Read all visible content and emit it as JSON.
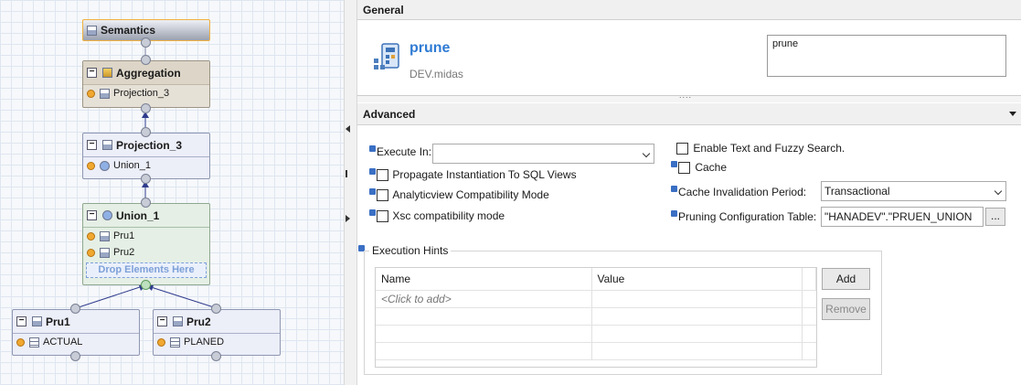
{
  "canvas": {
    "semantics": {
      "title": "Semantics"
    },
    "aggregation": {
      "title": "Aggregation",
      "inputs": [
        "Projection_3"
      ]
    },
    "projection": {
      "title": "Projection_3",
      "inputs": [
        "Union_1"
      ]
    },
    "union": {
      "title": "Union_1",
      "inputs": [
        "Pru1",
        "Pru2"
      ],
      "drop_hint": "Drop Elements Here"
    },
    "pru1": {
      "title": "Pru1",
      "inputs": [
        "ACTUAL"
      ]
    },
    "pru2": {
      "title": "Pru2",
      "inputs": [
        "PLANED"
      ]
    }
  },
  "general": {
    "section_title": "General",
    "object_name": "prune",
    "package": "DEV.midas",
    "description": "prune",
    "splitter_grip": "....",
    "accent_color": "#2f7bd3"
  },
  "advanced": {
    "section_title": "Advanced",
    "execute_in_label": "Execute In:",
    "execute_in_value": "",
    "propagate_label": "Propagate Instantiation To SQL Views",
    "analytic_label": "Analyticview Compatibility Mode",
    "xsc_label": "Xsc compatibility mode",
    "fuzzy_label": "Enable Text and Fuzzy Search.",
    "cache_label": "Cache",
    "cache_period_label": "Cache Invalidation Period:",
    "cache_period_value": "Transactional",
    "pruning_label": "Pruning Configuration Table:",
    "pruning_value": "\"HANADEV\".\"PRUEN_UNION",
    "browse_label": "...",
    "hints_title": "Execution Hints",
    "hints_columns": [
      "Name",
      "Value"
    ],
    "hints_placeholder": "<Click to add>",
    "add_label": "Add",
    "remove_label": "Remove"
  }
}
